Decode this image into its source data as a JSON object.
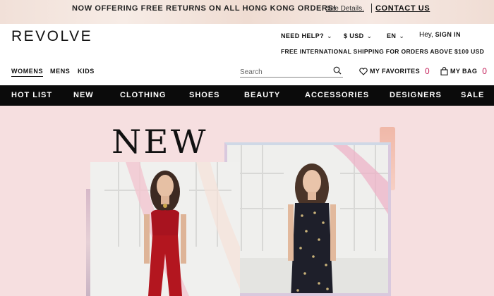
{
  "promo": {
    "message": "NOW OFFERING FREE RETURNS ON ALL HONG KONG ORDERS!",
    "details_link": "See Details.",
    "contact_link": "CONTACT US"
  },
  "header": {
    "logo": "REVOLVE",
    "need_help": "NEED HELP?",
    "currency": "$ USD",
    "language": "EN",
    "greeting_prefix": "Hey,",
    "sign_in": "SIGN IN",
    "shipping_notice": "FREE INTERNATIONAL SHIPPING FOR ORDERS ABOVE $100 USD"
  },
  "gender_tabs": [
    {
      "label": "WOMENS",
      "active": true
    },
    {
      "label": "MENS",
      "active": false
    },
    {
      "label": "KIDS",
      "active": false
    }
  ],
  "search": {
    "placeholder": "Search",
    "value": ""
  },
  "favorites": {
    "label": "MY FAVORITES",
    "count": "0"
  },
  "bag": {
    "label": "MY BAG",
    "count": "0"
  },
  "nav": {
    "items": [
      "HOT LIST",
      "NEW",
      "CLOTHING",
      "SHOES",
      "BEAUTY",
      "ACCESSORIES",
      "DESIGNERS",
      "SALE"
    ]
  },
  "hero": {
    "title": "NEW"
  },
  "colors": {
    "accent": "#c3205a",
    "nav_bg": "#0b0b0b",
    "hero_bg": "#f6dfe0"
  }
}
